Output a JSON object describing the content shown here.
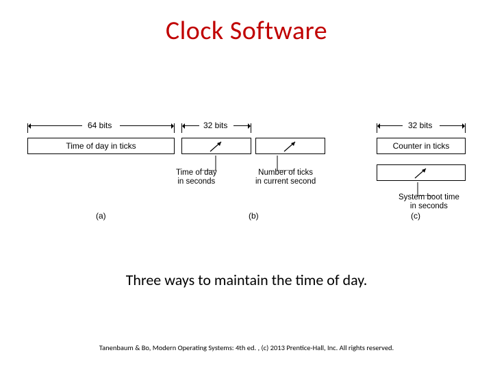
{
  "title": "Clock Software",
  "caption": "Three ways to maintain the time of day.",
  "footer": "Tanenbaum & Bo, Modern  Operating Systems: 4th ed. , (c) 2013 Prentice-Hall, Inc.  All rights reserved.",
  "fig": {
    "a": {
      "width_label": "64 bits",
      "box": "Time of day in ticks",
      "letter": "(a)"
    },
    "b": {
      "width_label": "32 bits",
      "sub1": "Time of day\nin seconds",
      "sub2": "Number of ticks\nin current second",
      "letter": "(b)"
    },
    "c": {
      "width_label": "32 bits",
      "box": "Counter in ticks",
      "sub": "System boot time\nin seconds",
      "letter": "(c)"
    }
  }
}
